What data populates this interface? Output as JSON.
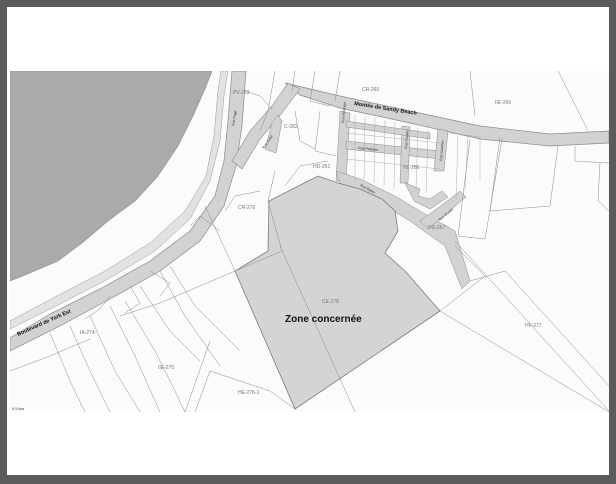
{
  "map": {
    "highlight_label": "Zone concernée",
    "roads": {
      "boulevard": "Boulevard de York Est",
      "montee": "Montée de Sandy Beach",
      "small": [
        "Rue Pagé",
        "Rue Dubé",
        "Rue Bélanger",
        "Rue Pelletier",
        "Rue Cloutier",
        "Rue Gauthier",
        "Rue Baker",
        "Rue Boulet"
      ]
    },
    "zones": {
      "pv263": "PV-263",
      "cr265": "CR-265",
      "ie266": "IIE-266",
      "c282": "C-282",
      "hd261": "HD-261",
      "hl266": "HL-266",
      "cr276": "CR-276",
      "hd267": "HD-267",
      "ce278": "CE-278",
      "ia274": "IA-274",
      "hf277": "HF-277",
      "ie275": "IIE-275",
      "he2761": "HE-276-1",
      "scale": "0.5 km"
    },
    "colors": {
      "water": "#aaaaaa",
      "highlight_zone": "#d4d4d4",
      "road_fill": "#d2d2d2",
      "lines": "#8a8a8a"
    }
  }
}
